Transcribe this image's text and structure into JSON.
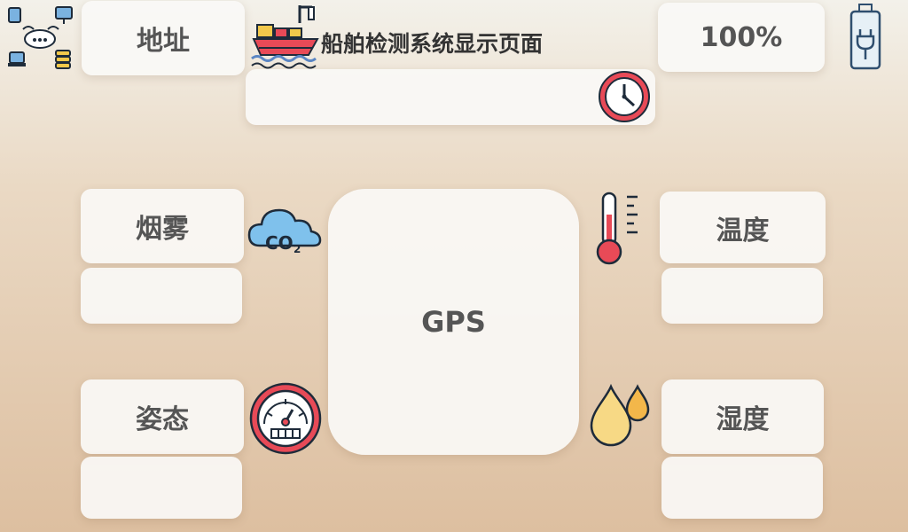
{
  "header": {
    "title": "船舶检测系统显示页面",
    "address_label": "地址",
    "battery_label": "100%"
  },
  "sensors": {
    "smoke_label": "烟雾",
    "temperature_label": "温度",
    "attitude_label": "姿态",
    "humidity_label": "湿度"
  },
  "center": {
    "gps_label": "GPS"
  },
  "colors": {
    "accent_red": "#e84a57",
    "icon_outline": "#1e2b3a",
    "water_blue": "#5a86c4",
    "drop_yellow": "#f7d985"
  },
  "icons": [
    "network-icon",
    "ship-icon",
    "clock-icon",
    "battery-icon",
    "co2-cloud-icon",
    "thermometer-icon",
    "gauge-icon",
    "water-drops-icon"
  ]
}
